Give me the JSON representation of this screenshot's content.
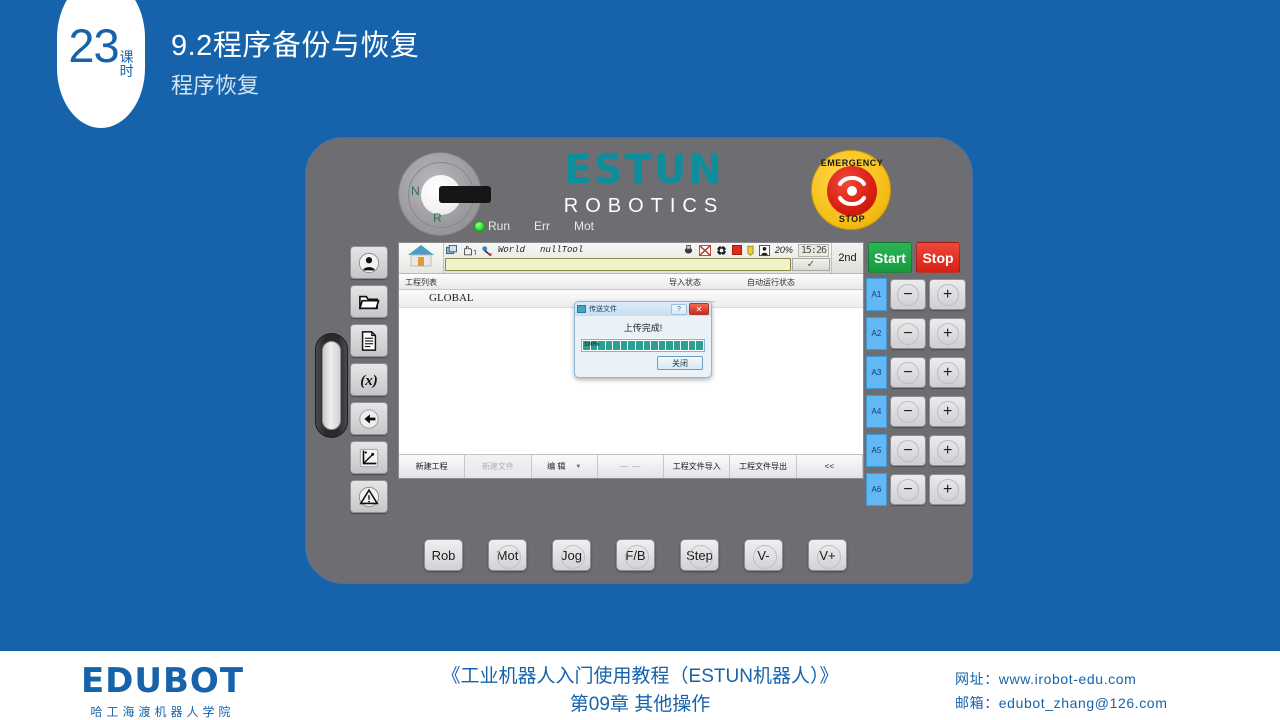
{
  "slide": {
    "lesson_number": "23",
    "lesson_unit_top": "课",
    "lesson_unit_bottom": "时",
    "title": "9.2程序备份与恢复",
    "subtitle": "程序恢复",
    "background_color": "#1663ab"
  },
  "pendant": {
    "brand": {
      "word": "ESTUN",
      "sub": "ROBOTICS",
      "color": "#0c8e9c"
    },
    "key_switch": {
      "label_left": "N",
      "label_bottom": "R"
    },
    "estop": {
      "text_top": "EMERGENCY",
      "text_bottom": "STOP",
      "body_color": "#d81e10",
      "ring_color": "#f5bd16"
    },
    "leds": [
      {
        "label": "Run",
        "state": "on"
      },
      {
        "label": "Err",
        "state": "off"
      },
      {
        "label": "Mot",
        "state": "off"
      }
    ],
    "sidebar": [
      {
        "name": "user-icon",
        "label": "User"
      },
      {
        "name": "folder-icon",
        "label": "Folder"
      },
      {
        "name": "document-icon",
        "label": "Document"
      },
      {
        "name": "variable-icon",
        "label": "(x)"
      },
      {
        "name": "io-arrow-icon",
        "label": "IO"
      },
      {
        "name": "coordinate-axes-icon",
        "label": "Coordinates"
      },
      {
        "name": "warning-icon",
        "label": "Alarm"
      }
    ],
    "status_bar": {
      "home": "home-icon",
      "coord_system": "World",
      "tool": "nullTool",
      "teach_mode": "T",
      "speed": "20%",
      "clock": "15:26",
      "message": "",
      "confirm": "✓",
      "second": "2nd",
      "icons": [
        "window-icon",
        "hand-teach-icon",
        "coordinate-icon",
        "io-icon",
        "no-motion-icon",
        "gear-icon",
        "stop-square-icon",
        "pen-icon",
        "person-icon"
      ]
    },
    "list": {
      "headers": [
        "工程列表",
        "导入状态",
        "自动运行状态"
      ],
      "rows": [
        {
          "name": "GLOBAL",
          "import_status": "— —",
          "auto_status": "— —"
        }
      ]
    },
    "dialog": {
      "title": "传送文件",
      "message": "上传完成!",
      "progress_percent": "100%",
      "progress_value": 100,
      "segments": 16,
      "close_button": "关闭",
      "help_button": "?",
      "close_x": "✕",
      "bar_color": "#2aa193"
    },
    "toolbar": [
      {
        "label": "新建工程",
        "state": "enabled"
      },
      {
        "label": "新建文件",
        "state": "disabled"
      },
      {
        "label": "编  辑",
        "state": "dropdown"
      },
      {
        "label": "—  —",
        "state": "dashes"
      },
      {
        "label": "工程文件导入",
        "state": "enabled"
      },
      {
        "label": "工程文件导出",
        "state": "enabled"
      },
      {
        "label": "<<",
        "state": "enabled"
      }
    ],
    "run_controls": [
      {
        "label": "Start",
        "color": "#179a3e"
      },
      {
        "label": "Stop",
        "color": "#d81f14"
      }
    ],
    "axes": [
      {
        "label": "A1",
        "minus": "−",
        "plus": "+"
      },
      {
        "label": "A2",
        "minus": "−",
        "plus": "+"
      },
      {
        "label": "A3",
        "minus": "−",
        "plus": "+"
      },
      {
        "label": "A4",
        "minus": "−",
        "plus": "+"
      },
      {
        "label": "A5",
        "minus": "−",
        "plus": "+"
      },
      {
        "label": "A6",
        "minus": "−",
        "plus": "+"
      }
    ],
    "hardware_buttons": [
      {
        "label": "Rob",
        "shape": "square"
      },
      {
        "label": "Mot",
        "shape": "round"
      },
      {
        "label": "Jog",
        "shape": "round"
      },
      {
        "label": "F/B",
        "shape": "round"
      },
      {
        "label": "Step",
        "shape": "round"
      },
      {
        "label": "V-",
        "shape": "round"
      },
      {
        "label": "V+",
        "shape": "round"
      }
    ]
  },
  "footer": {
    "logo_word": "EDUBOT",
    "logo_sub": "哈工海渡机器人学院",
    "center_line1": "《工业机器人入门使用教程（ESTUN机器人）》",
    "center_line2": "第09章  其他操作",
    "website": "网址：www.irobot-edu.com",
    "email": "邮箱：edubot_zhang@126.com",
    "accent_color": "#1663ab"
  }
}
